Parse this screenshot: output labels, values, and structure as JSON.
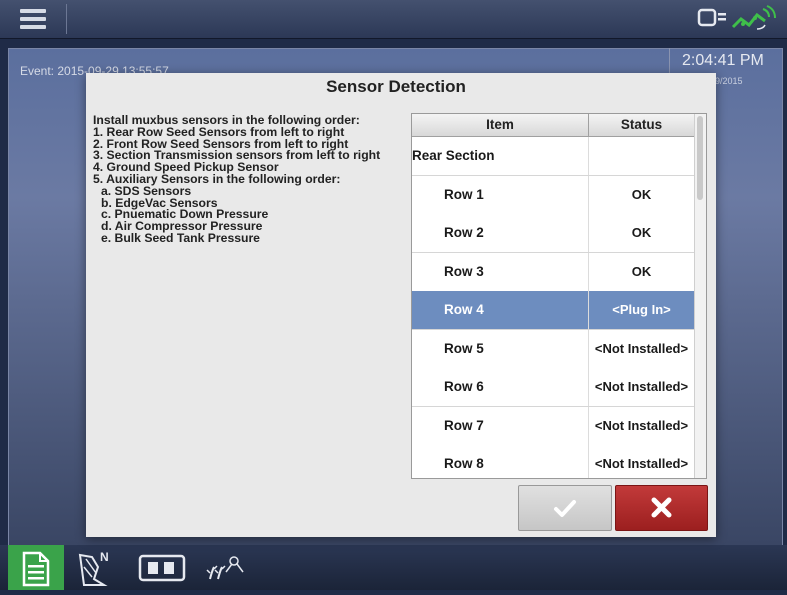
{
  "topbar": {
    "menu_icon": "hamburger-menu-icon",
    "status_icons": [
      "display-icon",
      "gps-signal-icon"
    ]
  },
  "background": {
    "event_text": "Event: 2015-09-29 13:55:57",
    "clock_time": "2:04:41 PM",
    "clock_date": "29/2015"
  },
  "dialog": {
    "title": "Sensor Detection",
    "instructions": [
      {
        "text": "Install muxbus sensors in the following order:",
        "indent": false
      },
      {
        "text": "1. Rear Row Seed Sensors from left to right",
        "indent": false
      },
      {
        "text": "2. Front Row Seed Sensors from left to right",
        "indent": false
      },
      {
        "text": "3. Section Transmission sensors from left to right",
        "indent": false
      },
      {
        "text": "4. Ground Speed Pickup Sensor",
        "indent": false
      },
      {
        "text": "5. Auxiliary Sensors in the following order:",
        "indent": false
      },
      {
        "text": "a. SDS Sensors",
        "indent": true
      },
      {
        "text": "b. EdgeVac Sensors",
        "indent": true
      },
      {
        "text": "c. Pnuematic Down Pressure",
        "indent": true
      },
      {
        "text": "d. Air Compressor Pressure",
        "indent": true
      },
      {
        "text": "e. Bulk Seed Tank Pressure",
        "indent": true
      }
    ],
    "table": {
      "headers": {
        "item": "Item",
        "status": "Status"
      },
      "rows": [
        {
          "item": "Rear Section",
          "status": "",
          "section": true,
          "selected": false
        },
        {
          "item": "Row 1",
          "status": "OK",
          "section": false,
          "selected": false
        },
        {
          "item": "Row 2",
          "status": "OK",
          "section": false,
          "selected": false
        },
        {
          "item": "Row 3",
          "status": "OK",
          "section": false,
          "selected": false
        },
        {
          "item": "Row 4",
          "status": "<Plug In>",
          "section": false,
          "selected": true
        },
        {
          "item": "Row 5",
          "status": "<Not Installed>",
          "section": false,
          "selected": false
        },
        {
          "item": "Row 6",
          "status": "<Not Installed>",
          "section": false,
          "selected": false
        },
        {
          "item": "Row 7",
          "status": "<Not Installed>",
          "section": false,
          "selected": false
        },
        {
          "item": "Row 8",
          "status": "<Not Installed>",
          "section": false,
          "selected": false
        }
      ]
    },
    "buttons": {
      "ok_icon": "checkmark-icon",
      "cancel_icon": "x-icon",
      "cancel_color": "#b02a2a"
    }
  },
  "bottombar": {
    "icons": [
      "document-icon",
      "field-map-icon",
      "planter-icon",
      "seed-plants-icon"
    ],
    "active_color": "#3aa34a"
  }
}
